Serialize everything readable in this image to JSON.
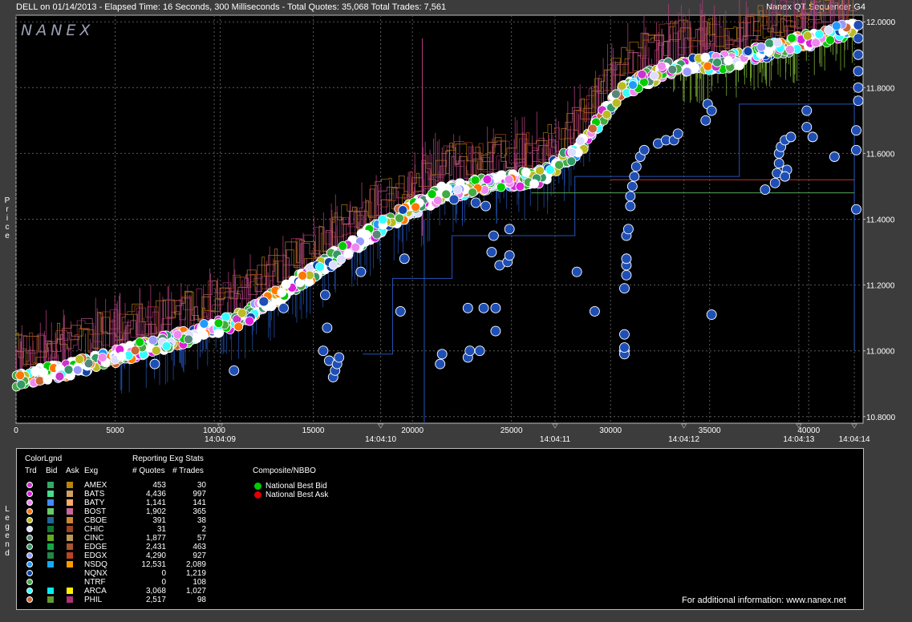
{
  "header": {
    "left": "DELL on 01/14/2013  -  Elapsed Time: 16 Seconds, 300 Milliseconds  -  Total Quotes: 35,068  Total Trades: 7,561",
    "right": "Nanex QT Sequencer G4"
  },
  "logo": "NANEX",
  "price_label": "Price",
  "legend_label": "Legend",
  "chart_data": {
    "type": "scatter",
    "title": "DELL on 01/14/2013",
    "x_range": [
      0,
      42500
    ],
    "y_range": [
      10.78,
      12.02
    ],
    "x_ticks": [
      0,
      5000,
      10000,
      15000,
      20000,
      25000,
      30000,
      35000,
      40000
    ],
    "x_tick_labels": [
      "0",
      "5000",
      "10000",
      "15000",
      "20000",
      "25000",
      "30000",
      "35000",
      "40000"
    ],
    "y_ticks": [
      10.8,
      11.0,
      11.2,
      11.4,
      11.6,
      11.8,
      12.0
    ],
    "y_tick_labels": [
      "10.8000",
      "11.0000",
      "11.2000",
      "11.4000",
      "11.6000",
      "11.8000",
      "12.0000"
    ],
    "time_labels": [
      {
        "x": 10300,
        "label": "14:04:09"
      },
      {
        "x": 18400,
        "label": "14:04:10"
      },
      {
        "x": 27200,
        "label": "14:04:11"
      },
      {
        "x": 33700,
        "label": "14:04:12"
      },
      {
        "x": 39500,
        "label": "14:04:13"
      },
      {
        "x": 42300,
        "label": "14:04:14"
      }
    ],
    "grid": true,
    "main_trend": [
      [
        0,
        10.91
      ],
      [
        3000,
        10.95
      ],
      [
        6000,
        11.0
      ],
      [
        9000,
        11.05
      ],
      [
        11500,
        11.1
      ],
      [
        14000,
        11.2
      ],
      [
        16500,
        11.3
      ],
      [
        19000,
        11.4
      ],
      [
        21500,
        11.48
      ],
      [
        24000,
        11.51
      ],
      [
        26500,
        11.53
      ],
      [
        28500,
        11.62
      ],
      [
        30500,
        11.79
      ],
      [
        33000,
        11.86
      ],
      [
        36000,
        11.88
      ],
      [
        38500,
        11.92
      ],
      [
        41000,
        11.96
      ],
      [
        42300,
        11.98
      ]
    ],
    "nsdq_trades": [
      [
        7000,
        10.96
      ],
      [
        11000,
        10.94
      ],
      [
        12500,
        11.15
      ],
      [
        13500,
        11.13
      ],
      [
        15500,
        11.0
      ],
      [
        15800,
        10.97
      ],
      [
        16000,
        10.92
      ],
      [
        16100,
        10.94
      ],
      [
        16200,
        10.96
      ],
      [
        16300,
        10.98
      ],
      [
        15700,
        11.07
      ],
      [
        15600,
        11.17
      ],
      [
        17400,
        11.24
      ],
      [
        19400,
        11.12
      ],
      [
        19600,
        11.28
      ],
      [
        21400,
        10.96
      ],
      [
        21500,
        10.99
      ],
      [
        22800,
        10.98
      ],
      [
        22900,
        11.0
      ],
      [
        23400,
        11.0
      ],
      [
        22800,
        11.13
      ],
      [
        23600,
        11.13
      ],
      [
        24200,
        11.13
      ],
      [
        24200,
        11.06
      ],
      [
        24000,
        11.3
      ],
      [
        24100,
        11.35
      ],
      [
        24400,
        11.26
      ],
      [
        24800,
        11.27
      ],
      [
        24900,
        11.29
      ],
      [
        24900,
        11.37
      ],
      [
        23200,
        11.45
      ],
      [
        23700,
        11.44
      ],
      [
        22100,
        11.46
      ],
      [
        28300,
        11.24
      ],
      [
        29200,
        11.12
      ],
      [
        30700,
        11.0
      ],
      [
        30700,
        10.99
      ],
      [
        30700,
        11.01
      ],
      [
        30700,
        11.05
      ],
      [
        30700,
        11.19
      ],
      [
        30800,
        11.23
      ],
      [
        30800,
        11.26
      ],
      [
        30800,
        11.28
      ],
      [
        30800,
        11.35
      ],
      [
        30900,
        11.37
      ],
      [
        31000,
        11.44
      ],
      [
        31000,
        11.47
      ],
      [
        31100,
        11.5
      ],
      [
        31200,
        11.53
      ],
      [
        31300,
        11.56
      ],
      [
        31500,
        11.59
      ],
      [
        31700,
        11.61
      ],
      [
        32400,
        11.63
      ],
      [
        32800,
        11.64
      ],
      [
        33200,
        11.64
      ],
      [
        33400,
        11.66
      ],
      [
        34800,
        11.7
      ],
      [
        34900,
        11.75
      ],
      [
        35100,
        11.73
      ],
      [
        35100,
        11.11
      ],
      [
        37800,
        11.49
      ],
      [
        38300,
        11.51
      ],
      [
        38400,
        11.54
      ],
      [
        38500,
        11.57
      ],
      [
        38500,
        11.6
      ],
      [
        38600,
        11.62
      ],
      [
        38800,
        11.64
      ],
      [
        39100,
        11.65
      ],
      [
        38900,
        11.55
      ],
      [
        38800,
        11.53
      ],
      [
        39900,
        11.68
      ],
      [
        40200,
        11.65
      ],
      [
        39900,
        11.73
      ],
      [
        41300,
        11.59
      ],
      [
        42400,
        11.43
      ],
      [
        42400,
        11.61
      ],
      [
        42400,
        11.67
      ],
      [
        42500,
        11.76
      ],
      [
        42500,
        11.8
      ],
      [
        42500,
        11.85
      ],
      [
        42500,
        11.9
      ],
      [
        42500,
        11.95
      ],
      [
        42500,
        11.99
      ]
    ]
  },
  "legend": {
    "title": "ColorLgnd",
    "col_trd": "Trd",
    "col_bid": "Bid",
    "col_ask": "Ask",
    "col_exg": "Exg",
    "stats_title": "Reporting Exg Stats",
    "col_quotes": "# Quotes",
    "col_trades": "# Trades",
    "composite_title": "Composite/NBBO",
    "nbb": "National Best Bid",
    "nba": "National Best Ask",
    "nbb_color": "#00cc00",
    "nba_color": "#e00000",
    "footer": "For additional information: www.nanex.net",
    "exchanges": [
      {
        "exg": "AMEX",
        "quotes": "453",
        "trades": "30",
        "trd": "#cc33cc",
        "bid": "#33aa66",
        "ask": "#b8860b"
      },
      {
        "exg": "BATS",
        "quotes": "4,436",
        "trades": "997",
        "trd": "#dd22dd",
        "bid": "#44dd88",
        "ask": "#d2a060"
      },
      {
        "exg": "BATY",
        "quotes": "1,141",
        "trades": "141",
        "trd": "#ee88ee",
        "bid": "#4488ff",
        "ask": "#ffaa66"
      },
      {
        "exg": "BOST",
        "quotes": "1,902",
        "trades": "365",
        "trd": "#ff7700",
        "bid": "#66cc66",
        "ask": "#cc6699"
      },
      {
        "exg": "CBOE",
        "quotes": "391",
        "trades": "38",
        "trd": "#bbbb22",
        "bid": "#226699",
        "ask": "#cc8833"
      },
      {
        "exg": "CHIC",
        "quotes": "31",
        "trades": "2",
        "trd": "#ddddff",
        "bid": "#117733",
        "ask": "#994422"
      },
      {
        "exg": "CINC",
        "quotes": "1,877",
        "trades": "57",
        "trd": "#558877",
        "bid": "#66aa22",
        "ask": "#bb9955"
      },
      {
        "exg": "EDGE",
        "quotes": "2,431",
        "trades": "463",
        "trd": "#339966",
        "bid": "#11aa44",
        "ask": "#aa5533"
      },
      {
        "exg": "EDGX",
        "quotes": "4,290",
        "trades": "927",
        "trd": "#9999ff",
        "bid": "#228844",
        "ask": "#bb4422"
      },
      {
        "exg": "NSDQ",
        "quotes": "12,531",
        "trades": "2,089",
        "trd": "#2299ff",
        "bid": "#11aaff",
        "ask": "#ff9900"
      },
      {
        "exg": "NQNX",
        "quotes": "0",
        "trades": "1,219",
        "trd": "#1144aa",
        "bid": "",
        "ask": ""
      },
      {
        "exg": "NTRF",
        "quotes": "0",
        "trades": "108",
        "trd": "#44aa44",
        "bid": "",
        "ask": ""
      },
      {
        "exg": "ARCA",
        "quotes": "3,068",
        "trades": "1,027",
        "trd": "#33ffff",
        "bid": "#00eeff",
        "ask": "#ffee00"
      },
      {
        "exg": "PHIL",
        "quotes": "2,517",
        "trades": "98",
        "trd": "#cc6633",
        "bid": "#669933",
        "ask": "#aa3377"
      }
    ]
  }
}
